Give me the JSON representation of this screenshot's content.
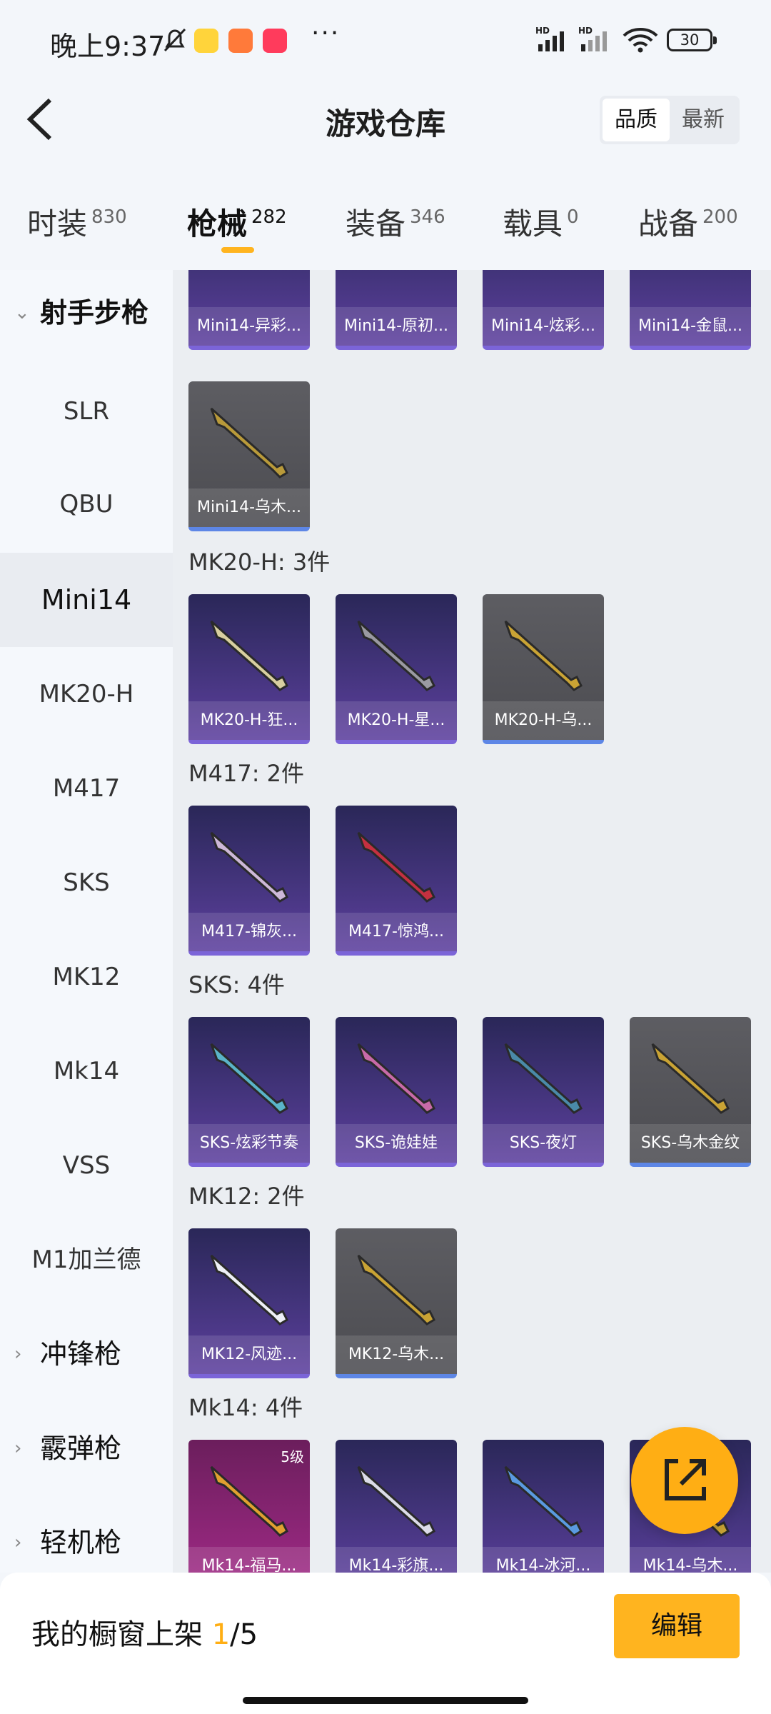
{
  "status_bar": {
    "time": "晚上9:37",
    "battery": "30",
    "hd1": "HD",
    "hd2": "HD",
    "dots": "···"
  },
  "header": {
    "title": "游戏仓库",
    "sort_options": [
      "品质",
      "最新"
    ],
    "active_sort": "品质"
  },
  "tabs": [
    {
      "label": "时装",
      "count": "830"
    },
    {
      "label": "枪械",
      "count": "282",
      "active": true
    },
    {
      "label": "装备",
      "count": "346"
    },
    {
      "label": "载具",
      "count": "0"
    },
    {
      "label": "战备",
      "count": "200"
    }
  ],
  "sidebar": {
    "group_top": "射手步枪",
    "items": [
      "SLR",
      "QBU",
      "Mini14",
      "MK20-H",
      "M417",
      "SKS",
      "MK12",
      "Mk14",
      "VSS",
      "M1加兰德"
    ],
    "active_item": "Mini14",
    "groups_bottom": [
      "冲锋枪",
      "霰弹枪",
      "轻机枪"
    ]
  },
  "content": {
    "partial_row": [
      "Mini14-异彩...",
      "Mini14-原初...",
      "Mini14-炫彩...",
      "Mini14-金鼠..."
    ],
    "mini14_last": "Mini14-乌木...",
    "sections": [
      {
        "title": "MK20-H: 3件",
        "items": [
          "MK20-H-狂...",
          "MK20-H-星...",
          "MK20-H-乌..."
        ]
      },
      {
        "title": "M417: 2件",
        "items": [
          "M417-锦灰...",
          "M417-惊鸿..."
        ]
      },
      {
        "title": "SKS: 4件",
        "items": [
          "SKS-炫彩节奏",
          "SKS-诡娃娃",
          "SKS-夜灯",
          "SKS-乌木金纹"
        ]
      },
      {
        "title": "MK12: 2件",
        "items": [
          "MK12-风迹...",
          "MK12-乌木..."
        ]
      },
      {
        "title": "Mk14: 4件",
        "items": [
          "Mk14-福马...",
          "Mk14-彩旗...",
          "Mk14-冰河...",
          "Mk14-乌木..."
        ],
        "level_badge": "5级"
      }
    ]
  },
  "bottom_bar": {
    "label": "我的橱窗上架 ",
    "current": "1",
    "total": "/5",
    "edit": "编辑"
  },
  "colors": {
    "accent": "#ffb41f",
    "card_purple": "#45357e",
    "card_gray": "#4c4c51",
    "card_pink": "#a02a86"
  }
}
